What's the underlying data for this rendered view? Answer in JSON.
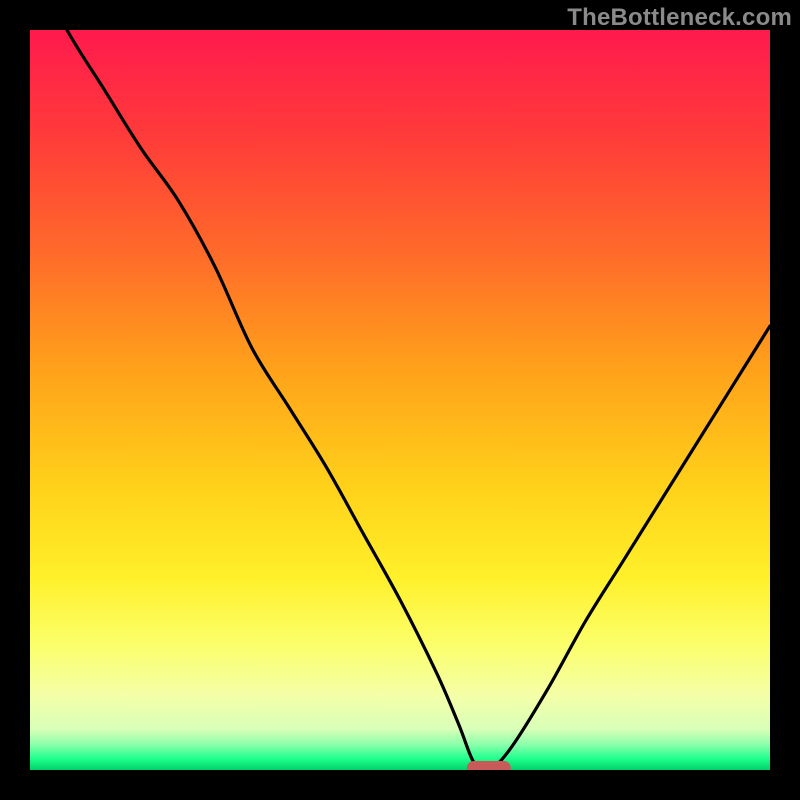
{
  "watermark": "TheBottleneck.com",
  "colors": {
    "frame": "#000000",
    "marker": "#c85a5a",
    "curve": "#000000",
    "gradient_stops": [
      {
        "offset": 0.0,
        "color": "#ff1a4d"
      },
      {
        "offset": 0.14,
        "color": "#ff3a3a"
      },
      {
        "offset": 0.3,
        "color": "#ff6a2a"
      },
      {
        "offset": 0.46,
        "color": "#ffa21a"
      },
      {
        "offset": 0.62,
        "color": "#ffd21a"
      },
      {
        "offset": 0.74,
        "color": "#fff02a"
      },
      {
        "offset": 0.83,
        "color": "#fbff6a"
      },
      {
        "offset": 0.9,
        "color": "#f4ffa8"
      },
      {
        "offset": 0.945,
        "color": "#d8ffb8"
      },
      {
        "offset": 0.965,
        "color": "#8effac"
      },
      {
        "offset": 0.985,
        "color": "#1eff8c"
      },
      {
        "offset": 1.0,
        "color": "#00d26a"
      }
    ]
  },
  "chart_data": {
    "type": "line",
    "title": "",
    "xlabel": "",
    "ylabel": "",
    "xlim": [
      0,
      100
    ],
    "ylim": [
      0,
      100
    ],
    "legend": false,
    "grid": false,
    "optimum_x": 62,
    "marker": {
      "x": 62,
      "y": 0,
      "width_pct": 6
    },
    "series": [
      {
        "name": "bottleneck-curve",
        "x": [
          0,
          5,
          10,
          15,
          20,
          25,
          30,
          35,
          40,
          45,
          50,
          55,
          58,
          60,
          62,
          65,
          70,
          75,
          80,
          85,
          90,
          95,
          100
        ],
        "values": [
          110,
          100,
          92,
          84,
          77,
          68,
          57,
          49,
          41,
          32,
          23,
          13,
          6,
          1,
          0,
          3,
          11,
          20,
          28,
          36,
          44,
          52,
          60
        ]
      }
    ],
    "annotations": []
  }
}
